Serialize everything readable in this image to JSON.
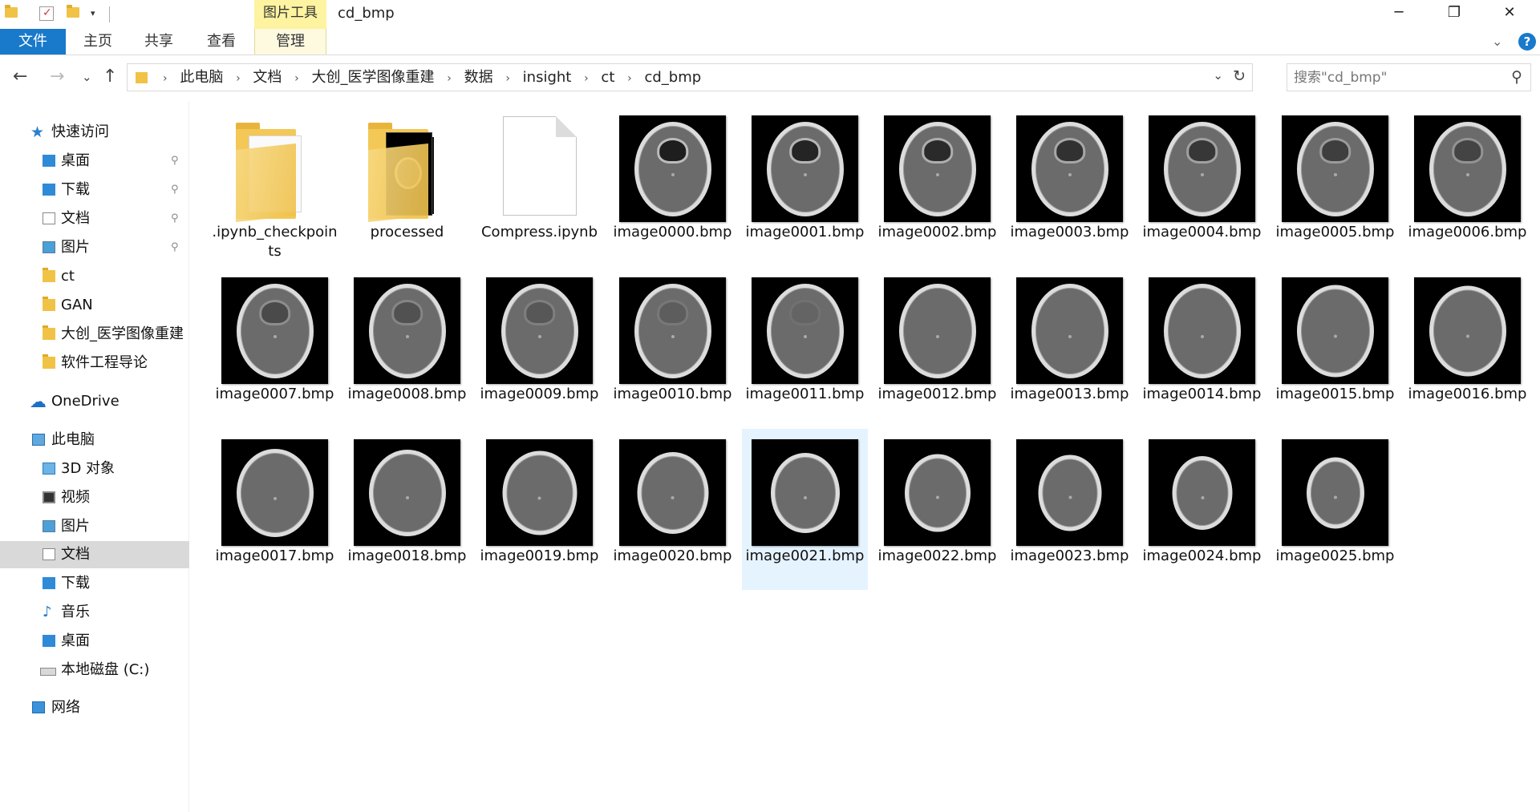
{
  "window": {
    "title": "cd_bmp",
    "context_tab_header": "图片工具",
    "minimize_glyph": "─",
    "maximize_glyph": "❐",
    "close_glyph": "✕"
  },
  "ribbon": {
    "tabs": [
      {
        "label": "文件"
      },
      {
        "label": "主页"
      },
      {
        "label": "共享"
      },
      {
        "label": "查看"
      },
      {
        "label": "管理"
      }
    ],
    "help_glyph": "?",
    "expand_glyph": "⌄"
  },
  "address": {
    "back_glyph": "←",
    "forward_glyph": "→",
    "recent_glyph": "⌄",
    "up_glyph": "↑",
    "crumbs": [
      "此电脑",
      "文档",
      "大创_医学图像重建",
      "数据",
      "insight",
      "ct",
      "cd_bmp"
    ],
    "separator": "›",
    "dropdown_glyph": "⌄",
    "refresh_glyph": "↻"
  },
  "search": {
    "placeholder": "搜索\"cd_bmp\"",
    "icon": "search-icon"
  },
  "nav": {
    "quick_access": "快速访问",
    "quick_items": [
      {
        "label": "桌面",
        "pinned": true,
        "icon": "desktop-icon"
      },
      {
        "label": "下载",
        "pinned": true,
        "icon": "download-icon"
      },
      {
        "label": "文档",
        "pinned": true,
        "icon": "document-icon"
      },
      {
        "label": "图片",
        "pinned": true,
        "icon": "picture-icon"
      },
      {
        "label": "ct",
        "pinned": false,
        "icon": "folder-icon"
      },
      {
        "label": "GAN",
        "pinned": false,
        "icon": "folder-icon"
      },
      {
        "label": "大创_医学图像重建",
        "pinned": false,
        "icon": "folder-icon"
      },
      {
        "label": "软件工程导论",
        "pinned": false,
        "icon": "folder-icon"
      }
    ],
    "onedrive": "OneDrive",
    "this_pc": "此电脑",
    "pc_items": [
      {
        "label": "3D 对象",
        "icon": "3d-objects-icon"
      },
      {
        "label": "视频",
        "icon": "video-icon"
      },
      {
        "label": "图片",
        "icon": "picture-icon"
      },
      {
        "label": "文档",
        "icon": "document-icon",
        "selected": true
      },
      {
        "label": "下载",
        "icon": "download-icon"
      },
      {
        "label": "音乐",
        "icon": "music-icon"
      },
      {
        "label": "桌面",
        "icon": "desktop-icon"
      },
      {
        "label": "本地磁盘 (C:)",
        "icon": "drive-icon"
      }
    ],
    "network": "网络",
    "pin_glyph": "📌"
  },
  "files": [
    {
      "name": ".ipynb_checkpoints",
      "kind": "folder"
    },
    {
      "name": "processed",
      "kind": "folder-images"
    },
    {
      "name": "Compress.ipynb",
      "kind": "file"
    },
    {
      "name": "image0000.bmp",
      "kind": "image"
    },
    {
      "name": "image0001.bmp",
      "kind": "image"
    },
    {
      "name": "image0002.bmp",
      "kind": "image"
    },
    {
      "name": "image0003.bmp",
      "kind": "image"
    },
    {
      "name": "image0004.bmp",
      "kind": "image"
    },
    {
      "name": "image0005.bmp",
      "kind": "image"
    },
    {
      "name": "image0006.bmp",
      "kind": "image"
    },
    {
      "name": "image0007.bmp",
      "kind": "image"
    },
    {
      "name": "image0008.bmp",
      "kind": "image"
    },
    {
      "name": "image0009.bmp",
      "kind": "image"
    },
    {
      "name": "image0010.bmp",
      "kind": "image"
    },
    {
      "name": "image0011.bmp",
      "kind": "image"
    },
    {
      "name": "image0012.bmp",
      "kind": "image"
    },
    {
      "name": "image0013.bmp",
      "kind": "image"
    },
    {
      "name": "image0014.bmp",
      "kind": "image"
    },
    {
      "name": "image0015.bmp",
      "kind": "image"
    },
    {
      "name": "image0016.bmp",
      "kind": "image"
    },
    {
      "name": "image0017.bmp",
      "kind": "image"
    },
    {
      "name": "image0018.bmp",
      "kind": "image"
    },
    {
      "name": "image0019.bmp",
      "kind": "image"
    },
    {
      "name": "image0020.bmp",
      "kind": "image"
    },
    {
      "name": "image0021.bmp",
      "kind": "image",
      "selected": true
    },
    {
      "name": "image0022.bmp",
      "kind": "image"
    },
    {
      "name": "image0023.bmp",
      "kind": "image"
    },
    {
      "name": "image0024.bmp",
      "kind": "image"
    },
    {
      "name": "image0025.bmp",
      "kind": "image"
    }
  ],
  "colors": {
    "file_tab": "#1979ca",
    "context_tab": "#fdf3a0",
    "selection": "#e5f3ff",
    "nav_selection": "#d9d9d9",
    "folder": "#f0c347"
  }
}
